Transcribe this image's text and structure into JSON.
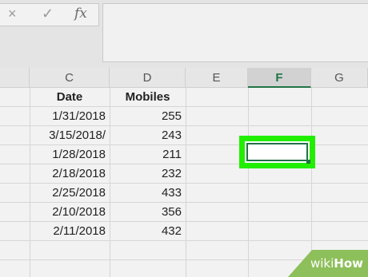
{
  "formula_bar": {
    "cancel_icon": "×",
    "enter_icon": "✓",
    "function_label": "fx",
    "content": ""
  },
  "columns": [
    "C",
    "D",
    "E",
    "F",
    "G"
  ],
  "active_column": "F",
  "table": {
    "headers": [
      "Date",
      "Mobiles"
    ],
    "rows": [
      [
        "1/31/2018",
        "255"
      ],
      [
        "3/15/2018/",
        "243"
      ],
      [
        "1/28/2018",
        "211"
      ],
      [
        "2/18/2018",
        "232"
      ],
      [
        "2/25/2018",
        "433"
      ],
      [
        "2/10/2018",
        "356"
      ],
      [
        "2/11/2018",
        "432"
      ]
    ]
  },
  "selected_cell": {
    "column": "F",
    "value": ""
  },
  "watermark": {
    "part1": "wiki",
    "part2": "How"
  },
  "colors": {
    "selection_highlight": "#22ee00",
    "excel_green": "#217346",
    "watermark_green": "#8dbf5a"
  }
}
